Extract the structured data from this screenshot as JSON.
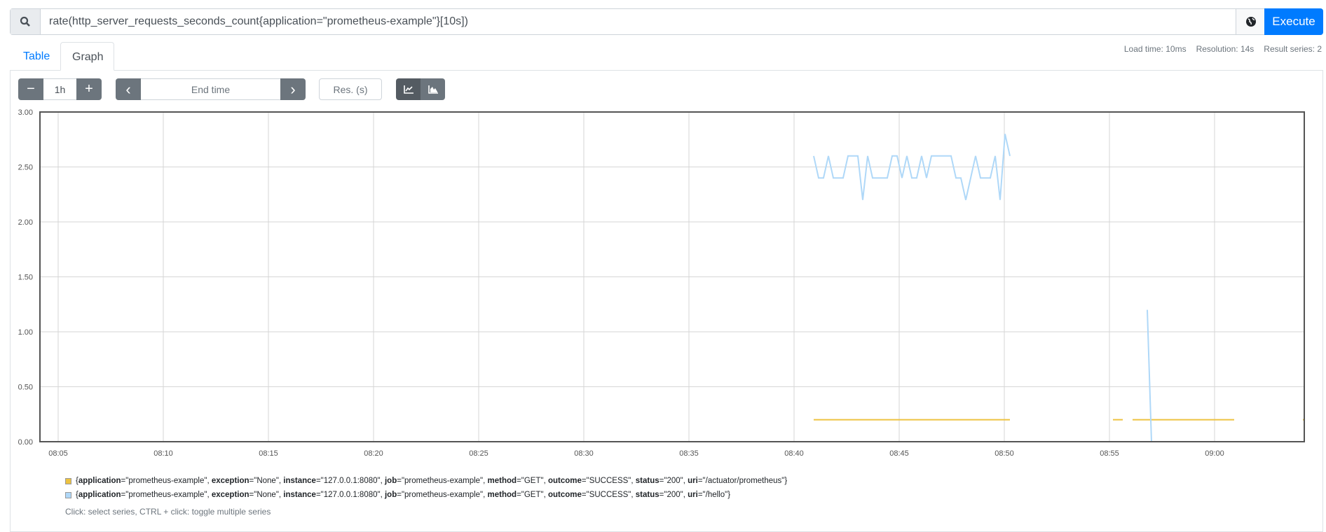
{
  "query": {
    "value": "rate(http_server_requests_seconds_count{application=\"prometheus-example\"}[10s])",
    "search_icon": "search-icon",
    "globe_icon": "globe-icon",
    "execute_label": "Execute"
  },
  "tabs": [
    {
      "label": "Table",
      "active": false
    },
    {
      "label": "Graph",
      "active": true
    }
  ],
  "stats": {
    "load_time": "Load time: 10ms",
    "resolution": "Resolution: 14s",
    "result_series": "Result series: 2"
  },
  "controls": {
    "minus": "−",
    "range": "1h",
    "plus": "+",
    "prev": "‹",
    "end_time": "End time",
    "next": "›",
    "resolution": "Res. (s)",
    "line_icon": "line-chart-icon",
    "stacked_icon": "area-chart-icon"
  },
  "colors": {
    "accent": "#007bff",
    "series1": "#edc240",
    "series2": "#afd8f8"
  },
  "chart_data": {
    "type": "line",
    "xlim": [
      "08:04:08",
      "09:04:16"
    ],
    "ylim": [
      0,
      3
    ],
    "yticks": [
      "0.00",
      "0.50",
      "1.00",
      "1.50",
      "2.00",
      "2.50",
      "3.00"
    ],
    "xticks": [
      "08:05",
      "08:10",
      "08:15",
      "08:20",
      "08:25",
      "08:30",
      "08:35",
      "08:40",
      "08:45",
      "08:50",
      "08:55",
      "09:00"
    ],
    "grid": true,
    "legend_position": "bottom",
    "series": [
      {
        "name": "{application=\"prometheus-example\", exception=\"None\", instance=\"127.0.0.1:8080\", job=\"prometheus-example\", method=\"GET\", outcome=\"SUCCESS\", status=\"200\", uri=\"/actuator/prometheus\"}",
        "color": "#edc240",
        "segments": [
          [
            [
              "08:40:56",
              0.2
            ],
            [
              "08:50:16",
              0.2
            ]
          ],
          [
            [
              "08:55:10",
              0.2
            ],
            [
              "08:55:38",
              0.2
            ]
          ],
          [
            [
              "08:56:06",
              0.2
            ],
            [
              "09:00:56",
              0.2
            ]
          ],
          [
            [
              "09:04:12",
              0.2
            ],
            [
              "09:04:16",
              0.2
            ]
          ]
        ]
      },
      {
        "name": "{application=\"prometheus-example\", exception=\"None\", instance=\"127.0.0.1:8080\", job=\"prometheus-example\", method=\"GET\", outcome=\"SUCCESS\", status=\"200\", uri=\"/hello\"}",
        "color": "#afd8f8",
        "segments": [
          {
            "start": "08:40:56",
            "step_s": 14,
            "values": [
              2.6,
              2.4,
              2.4,
              2.6,
              2.4,
              2.4,
              2.4,
              2.6,
              2.6,
              2.6,
              2.2,
              2.6,
              2.4,
              2.4,
              2.4,
              2.4,
              2.6,
              2.6,
              2.4,
              2.6,
              2.4,
              2.4,
              2.6,
              2.4,
              2.6,
              2.6,
              2.6,
              2.6,
              2.6,
              2.4,
              2.4,
              2.2,
              2.4,
              2.6,
              2.4,
              2.4,
              2.4,
              2.6,
              2.2,
              2.8,
              2.6
            ]
          },
          [
            [
              "08:56:48",
              1.2
            ],
            [
              "08:57:00",
              0
            ],
            [
              "09:00:56",
              0
            ]
          ],
          [
            [
              "09:04:12",
              0
            ],
            [
              "09:04:16",
              0
            ]
          ]
        ]
      }
    ]
  },
  "legend": {
    "items": [
      {
        "parts": [
          [
            "{",
            ""
          ],
          [
            "application",
            "=\"prometheus-example\", "
          ],
          [
            "exception",
            "=\"None\", "
          ],
          [
            "instance",
            "=\"127.0.0.1:8080\", "
          ],
          [
            "job",
            "=\"prometheus-example\", "
          ],
          [
            "method",
            "=\"GET\", "
          ],
          [
            "outcome",
            "=\"SUCCESS\", "
          ],
          [
            "status",
            "=\"200\", "
          ],
          [
            "uri",
            "=\"/actuator/prometheus\"}"
          ]
        ]
      },
      {
        "parts": [
          [
            "{",
            ""
          ],
          [
            "application",
            "=\"prometheus-example\", "
          ],
          [
            "exception",
            "=\"None\", "
          ],
          [
            "instance",
            "=\"127.0.0.1:8080\", "
          ],
          [
            "job",
            "=\"prometheus-example\", "
          ],
          [
            "method",
            "=\"GET\", "
          ],
          [
            "outcome",
            "=\"SUCCESS\", "
          ],
          [
            "status",
            "=\"200\", "
          ],
          [
            "uri",
            "=\"/hello\"}"
          ]
        ]
      }
    ],
    "hint": "Click: select series, CTRL + click: toggle multiple series"
  }
}
